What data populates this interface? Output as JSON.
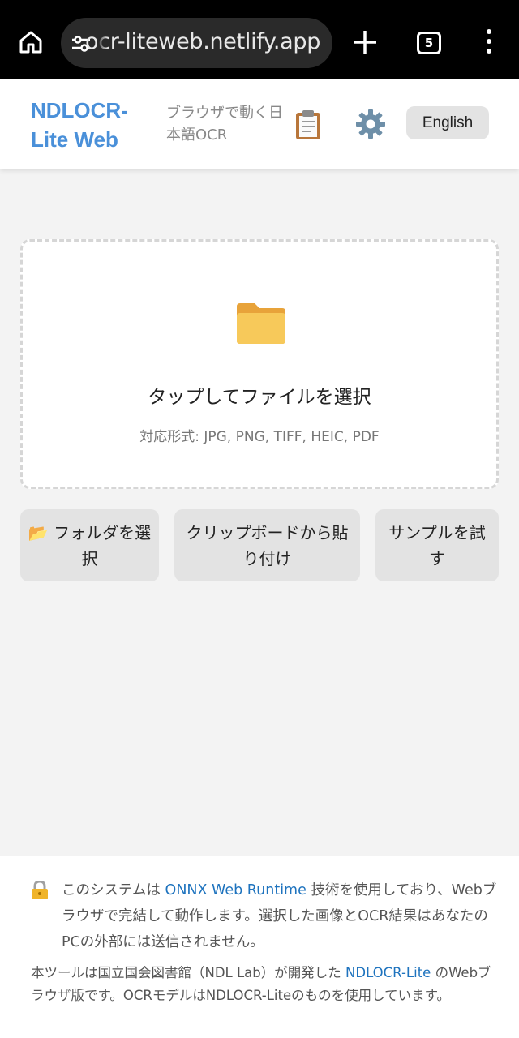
{
  "browser": {
    "url": "ocr-liteweb.netlify.app",
    "tab_count": "5"
  },
  "header": {
    "title": "NDLOCR-Lite Web",
    "subtitle": "ブラウザで動く日本語OCR",
    "clipboard_icon": "clipboard-icon",
    "settings_icon": "gear-icon",
    "language_button": "English"
  },
  "dropzone": {
    "icon": "folder-icon",
    "title": "タップしてファイルを選択",
    "formats": "対応形式: JPG, PNG, TIFF, HEIC, PDF"
  },
  "actions": {
    "folder_icon": "open-folder-icon",
    "folder_label": "フォルダを選択",
    "clipboard_label": "クリップボードから貼り付け",
    "sample_label": "サンプルを試す"
  },
  "footer": {
    "privacy_pre": "このシステムは ",
    "privacy_link": "ONNX Web Runtime",
    "privacy_post": " 技術を使用しており、Webブラウザで完結して動作します。選択した画像とOCR結果はあなたのPCの外部には送信されません。",
    "credit_pre": "本ツールは国立国会図書館（NDL Lab）が開発した ",
    "credit_link": "NDLOCR-Lite",
    "credit_post": " のWebブラウザ版です。OCRモデルはNDLOCR-Liteのものを使用しています。"
  },
  "colors": {
    "accent": "#4a90d9",
    "link": "#1e73be",
    "background": "#f3f3f3",
    "button": "#e3e3e3"
  }
}
